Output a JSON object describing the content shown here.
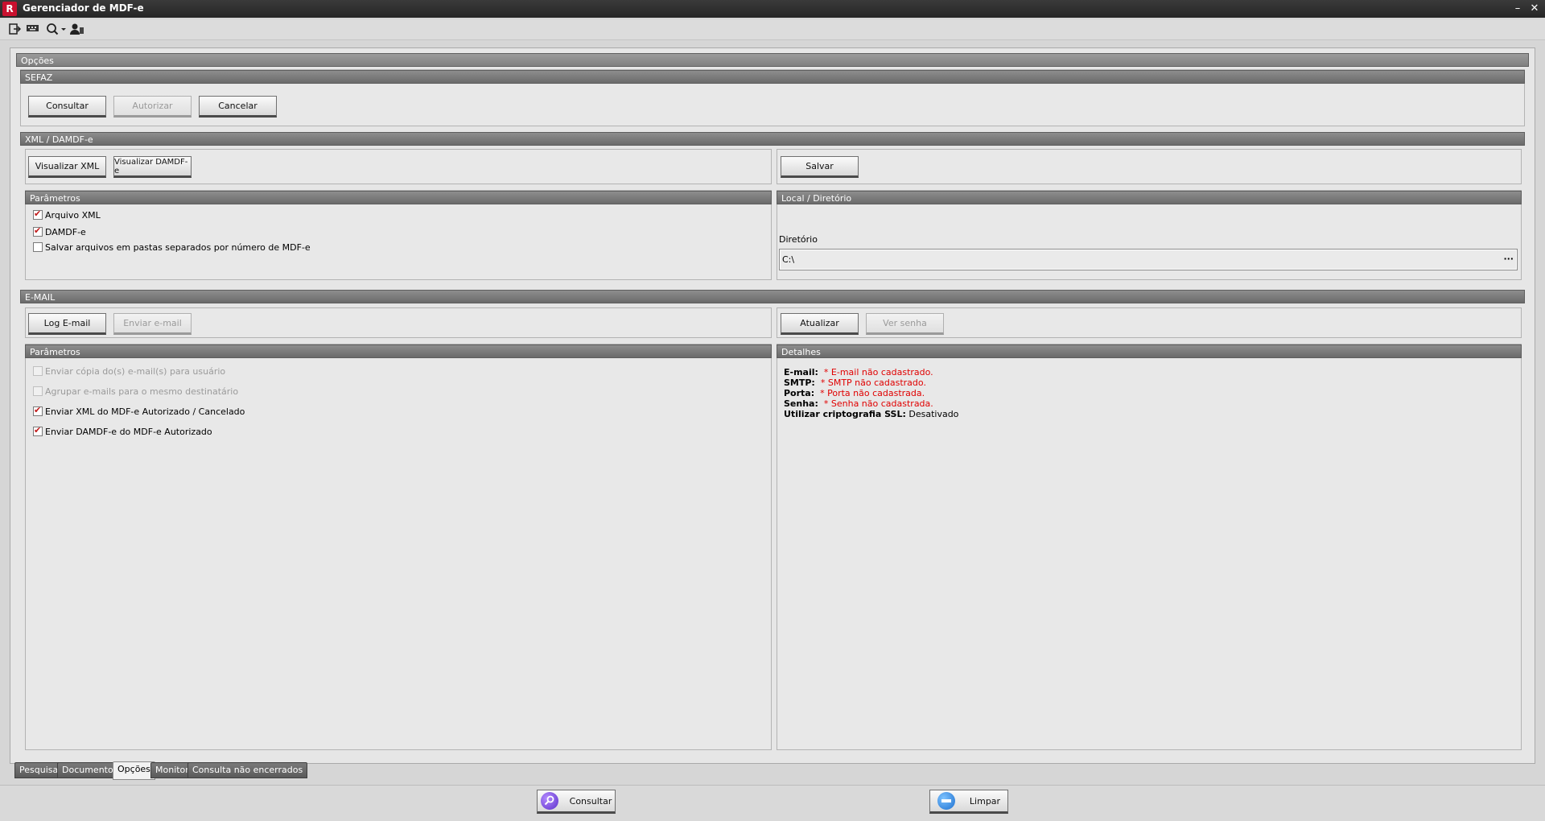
{
  "window": {
    "title": "Gerenciador de MDF-e",
    "app_icon_glyph": "R",
    "minimize": "–",
    "close": "✕"
  },
  "toolbar": {
    "icons": [
      "exit-icon",
      "keyboard-icon",
      "search-dropdown-icon",
      "user-icon"
    ]
  },
  "opcoes": {
    "header": "Opções",
    "sefaz": {
      "header": "SEFAZ",
      "consultar": "Consultar",
      "autorizar": "Autorizar",
      "cancelar": "Cancelar"
    },
    "xml": {
      "header": "XML / DAMDF-e",
      "visualizar_xml": "Visualizar XML",
      "visualizar_damdfe": "Visualizar DAMDF-e",
      "salvar": "Salvar",
      "parametros": {
        "header": "Parâmetros",
        "items": [
          {
            "label": "Arquivo XML",
            "checked": true
          },
          {
            "label": "DAMDF-e",
            "checked": true
          },
          {
            "label": "Salvar arquivos em pastas separados por número de MDF-e",
            "checked": false
          }
        ]
      },
      "local": {
        "header": "Local / Diretório",
        "diretorio_label": "Diretório",
        "diretorio_value": "C:\\",
        "browse": "···"
      }
    },
    "email": {
      "header": "E-MAIL",
      "log_email": "Log E-mail",
      "enviar_email": "Enviar e-mail",
      "atualizar": "Atualizar",
      "ver_senha": "Ver senha",
      "parametros": {
        "header": "Parâmetros",
        "items": [
          {
            "label": "Enviar cópia do(s) e-mail(s) para usuário",
            "checked": false,
            "disabled": true
          },
          {
            "label": "Agrupar e-mails para o mesmo destinatário",
            "checked": false,
            "disabled": true
          },
          {
            "label": "Enviar XML do MDF-e Autorizado / Cancelado",
            "checked": true,
            "disabled": false
          },
          {
            "label": "Enviar DAMDF-e do MDF-e Autorizado",
            "checked": true,
            "disabled": false
          }
        ]
      },
      "detalhes": {
        "header": "Detalhes",
        "email_label": "E-mail:",
        "email_value": "* E-mail não cadastrado.",
        "smtp_label": "SMTP:",
        "smtp_value": "* SMTP não cadastrado.",
        "porta_label": "Porta:",
        "porta_value": "* Porta não cadastrada.",
        "senha_label": "Senha:",
        "senha_value": "* Senha não cadastrada.",
        "ssl_label": "Utilizar criptografia SSL:",
        "ssl_value": "Desativado"
      }
    }
  },
  "tabs": [
    "Pesquisa",
    "Documentos",
    "Opções",
    "Monitor",
    "Consulta não encerrados"
  ],
  "active_tab": "Opções",
  "bottom": {
    "consultar": "Consultar",
    "limpar": "Limpar"
  },
  "colors": {
    "error_red": "#e00000",
    "title_bar": "#2e2e2e",
    "brand_red": "#c8102e"
  }
}
